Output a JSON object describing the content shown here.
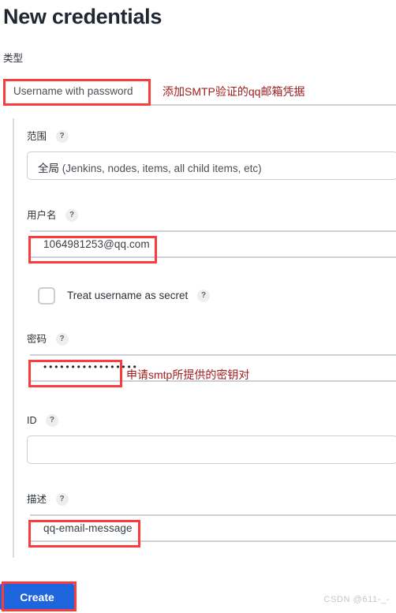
{
  "page": {
    "title": "New credentials"
  },
  "type_section": {
    "label": "类型",
    "selected": "Username with password",
    "annotation": "添加SMTP验证的qq邮箱凭据"
  },
  "form": {
    "scope": {
      "label": "范围",
      "help": "?",
      "value_zh": "全局",
      "value_en": " (Jenkins, nodes, items, all child items, etc)"
    },
    "username": {
      "label": "用户名",
      "help": "?",
      "value": "1064981253@qq.com"
    },
    "treat_as_secret": {
      "label": "Treat username as secret",
      "help": "?",
      "checked": false
    },
    "password": {
      "label": "密码",
      "help": "?",
      "masked_value": "•••••••••••••••••",
      "annotation": "申请smtp所提供的密钥对"
    },
    "id": {
      "label": "ID",
      "help": "?",
      "value": ""
    },
    "description": {
      "label": "描述",
      "help": "?",
      "value": "qq-email-message"
    }
  },
  "actions": {
    "create_label": "Create"
  },
  "watermark": {
    "text": "CSDN @611-_-"
  },
  "colors": {
    "accent_blue": "#1e64dc",
    "highlight_red": "#fa3c3c",
    "annotation_red": "#a11d1d",
    "border_grey": "#c8d0d6"
  }
}
